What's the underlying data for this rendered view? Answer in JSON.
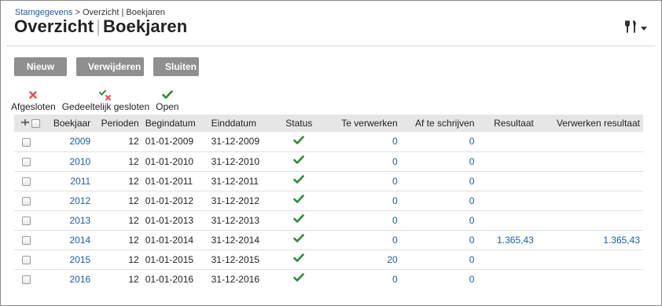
{
  "breadcrumb": {
    "link": "Stamgegevens",
    "separator": ">",
    "current": "Overzicht | Boekjaren"
  },
  "title": {
    "part1": "Overzicht",
    "sep": "|",
    "part2": "Boekjaren"
  },
  "toolbar": {
    "new_label": "Nieuw",
    "delete_label": "Verwijderen",
    "close_label": "Sluiten"
  },
  "legend": {
    "closed": "Afgesloten",
    "partial": "Gedeeltelijk gesloten",
    "open": "Open"
  },
  "table": {
    "headers": {
      "boekjaar": "Boekjaar",
      "perioden": "Perioden",
      "begindatum": "Begindatum",
      "einddatum": "Einddatum",
      "status": "Status",
      "te_verwerken": "Te verwerken",
      "af_te_schrijven": "Af te schrijven",
      "resultaat": "Resultaat",
      "verwerken_resultaat": "Verwerken resultaat"
    },
    "rows": [
      {
        "year": "2009",
        "periods": "12",
        "begin": "01-01-2009",
        "end": "31-12-2009",
        "status": "open",
        "to_process": "0",
        "to_write_off": "0",
        "result": "",
        "process_result": ""
      },
      {
        "year": "2010",
        "periods": "12",
        "begin": "01-01-2010",
        "end": "31-12-2010",
        "status": "open",
        "to_process": "0",
        "to_write_off": "0",
        "result": "",
        "process_result": ""
      },
      {
        "year": "2011",
        "periods": "12",
        "begin": "01-01-2011",
        "end": "31-12-2011",
        "status": "open",
        "to_process": "0",
        "to_write_off": "0",
        "result": "",
        "process_result": ""
      },
      {
        "year": "2012",
        "periods": "12",
        "begin": "01-01-2012",
        "end": "31-12-2012",
        "status": "open",
        "to_process": "0",
        "to_write_off": "0",
        "result": "",
        "process_result": ""
      },
      {
        "year": "2013",
        "periods": "12",
        "begin": "01-01-2013",
        "end": "31-12-2013",
        "status": "open",
        "to_process": "0",
        "to_write_off": "0",
        "result": "",
        "process_result": ""
      },
      {
        "year": "2014",
        "periods": "12",
        "begin": "01-01-2014",
        "end": "31-12-2014",
        "status": "open",
        "to_process": "0",
        "to_write_off": "0",
        "result": "1.365,43",
        "process_result": "1.365,43"
      },
      {
        "year": "2015",
        "periods": "12",
        "begin": "01-01-2015",
        "end": "31-12-2015",
        "status": "open",
        "to_process": "20",
        "to_write_off": "0",
        "result": "",
        "process_result": ""
      },
      {
        "year": "2016",
        "periods": "12",
        "begin": "01-01-2016",
        "end": "31-12-2016",
        "status": "open",
        "to_process": "0",
        "to_write_off": "0",
        "result": "",
        "process_result": ""
      }
    ]
  },
  "icons": {
    "tools": "tools-icon",
    "closed": "red-cross-icon",
    "partial": "partial-check-icon",
    "open": "green-check-icon",
    "expand": "expand-columns-icon"
  },
  "colors": {
    "link": "#1a5fa8",
    "check": "#2e8b3a",
    "cross": "#d9534f",
    "button": "#8f8f8f",
    "header_bg": "#e6e6e6"
  }
}
